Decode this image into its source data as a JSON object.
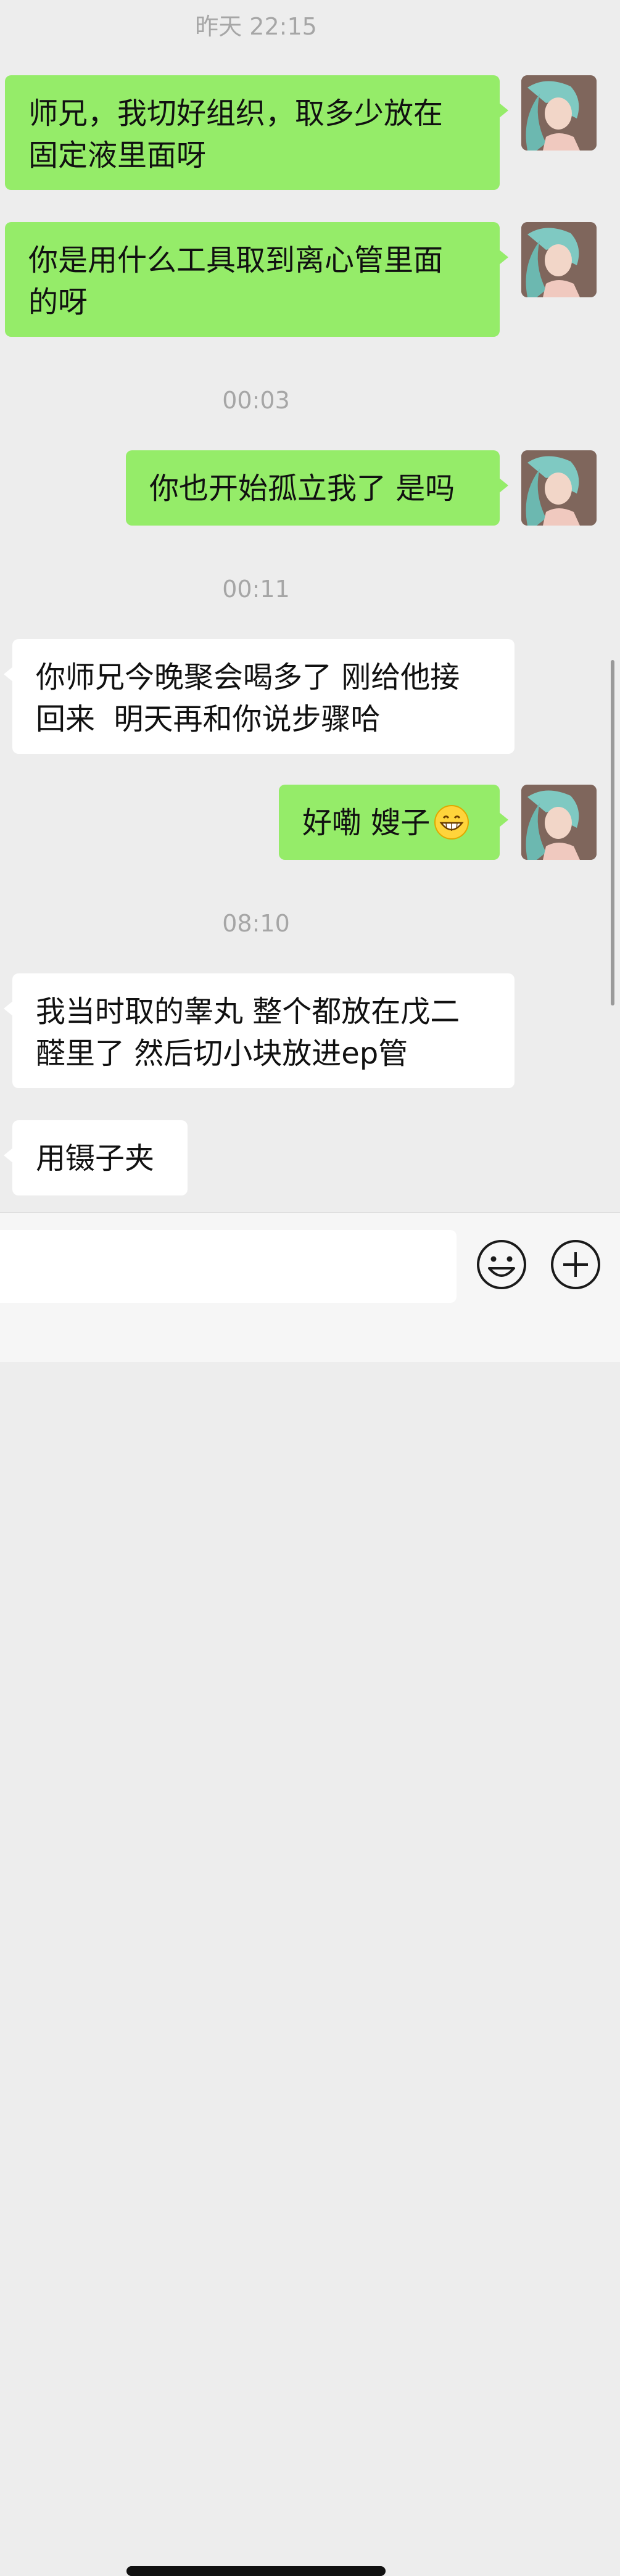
{
  "messages": [
    {
      "type": "time",
      "text": "昨天 22:15"
    },
    {
      "type": "outgoing",
      "text": "师兄，我切好组织，取多少放在\n固定液里面呀"
    },
    {
      "type": "outgoing",
      "text": "你是用什么工具取到离心管里面\n的呀"
    },
    {
      "type": "time",
      "text": "00:03"
    },
    {
      "type": "outgoing",
      "text": "你也开始孤立我了 是吗"
    },
    {
      "type": "time",
      "text": "00:11"
    },
    {
      "type": "incoming",
      "text": "你师兄今晚聚会喝多了 刚给他接\n回来  明天再和你说步骤哈"
    },
    {
      "type": "outgoing",
      "text": "好嘞 嫂子",
      "emoji": "grinning-emoji"
    },
    {
      "type": "time",
      "text": "08:10"
    },
    {
      "type": "incoming",
      "text": "我当时取的睾丸 整个都放在戊二\n醛里了 然后切小块放进ep管"
    },
    {
      "type": "incoming",
      "text": "用镊子夹"
    }
  ],
  "input_bar": {
    "emoji_button_icon": "smiley-icon",
    "more_button_icon": "plus-circle-icon"
  },
  "colors": {
    "background": "#ededed",
    "outgoing_bubble": "#95ec69",
    "incoming_bubble": "#ffffff",
    "timestamp": "#a6a6a6"
  }
}
